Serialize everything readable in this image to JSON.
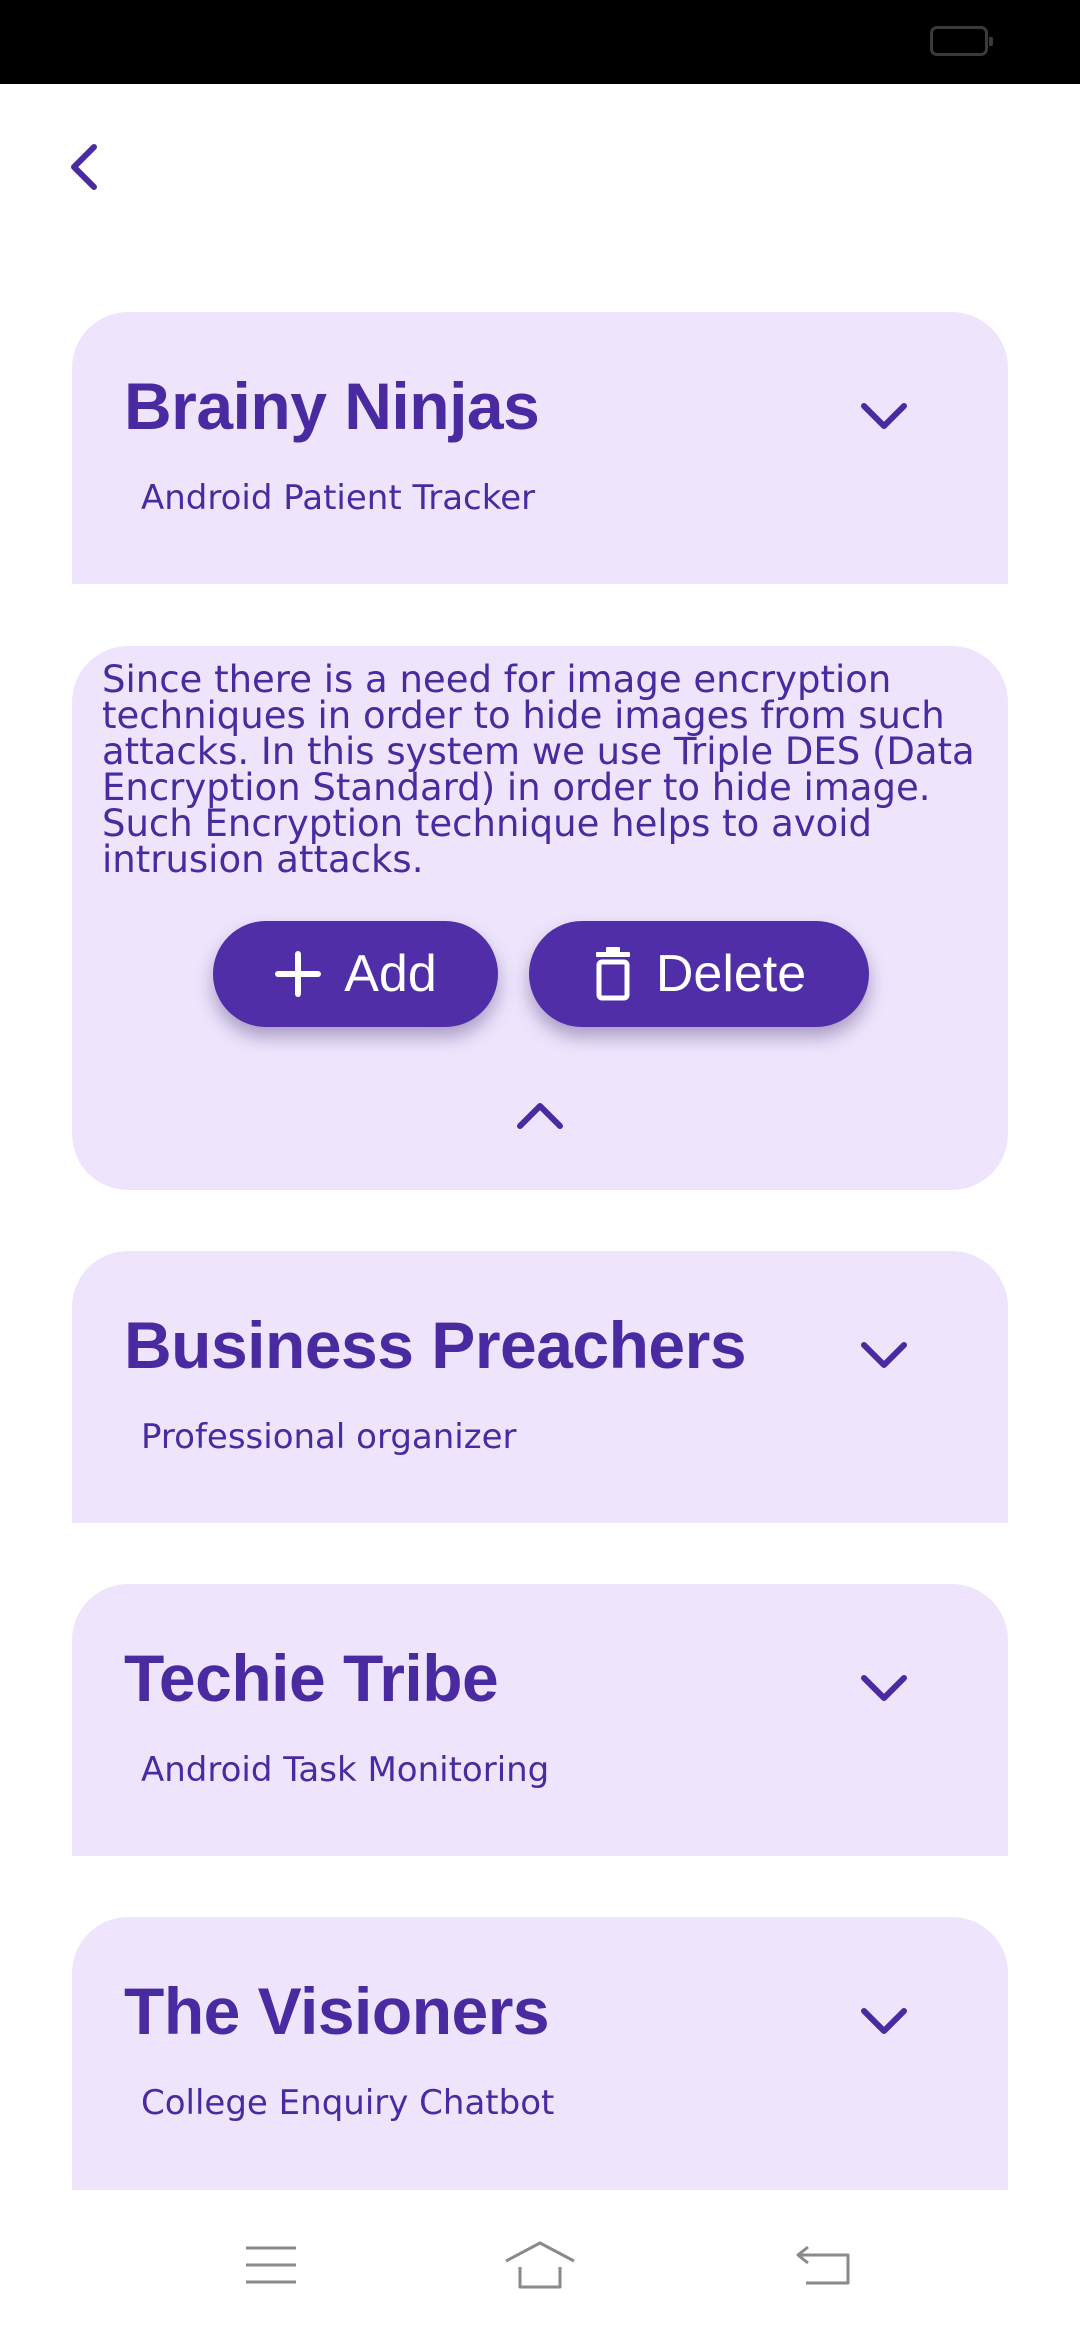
{
  "colors": {
    "accent": "#4f2ea7",
    "card_bg": "#eee5fd",
    "text": "#4a2aa0"
  },
  "teams": [
    {
      "name": "Brainy Ninjas",
      "project": "Android Patient Tracker"
    },
    {
      "name": "Business Preachers",
      "project": "Professional organizer"
    },
    {
      "name": "Techie Tribe",
      "project": "Android Task Monitoring"
    },
    {
      "name": "The Visioners",
      "project": "College Enquiry Chatbot"
    }
  ],
  "expanded": {
    "description": "Since there is a need for image encryption techniques in order to hide images from such attacks. In this system we use Triple DES (Data Encryption Standard) in order to hide image. Such Encryption technique helps to avoid intrusion attacks.",
    "add_label": "Add",
    "delete_label": "Delete"
  },
  "icons": {
    "back": "chevron-left-icon",
    "expand": "chevron-down-icon",
    "collapse": "chevron-up-icon",
    "add": "plus-icon",
    "delete": "trash-icon",
    "nav": [
      "menu-icon",
      "home-icon",
      "back-icon"
    ]
  }
}
